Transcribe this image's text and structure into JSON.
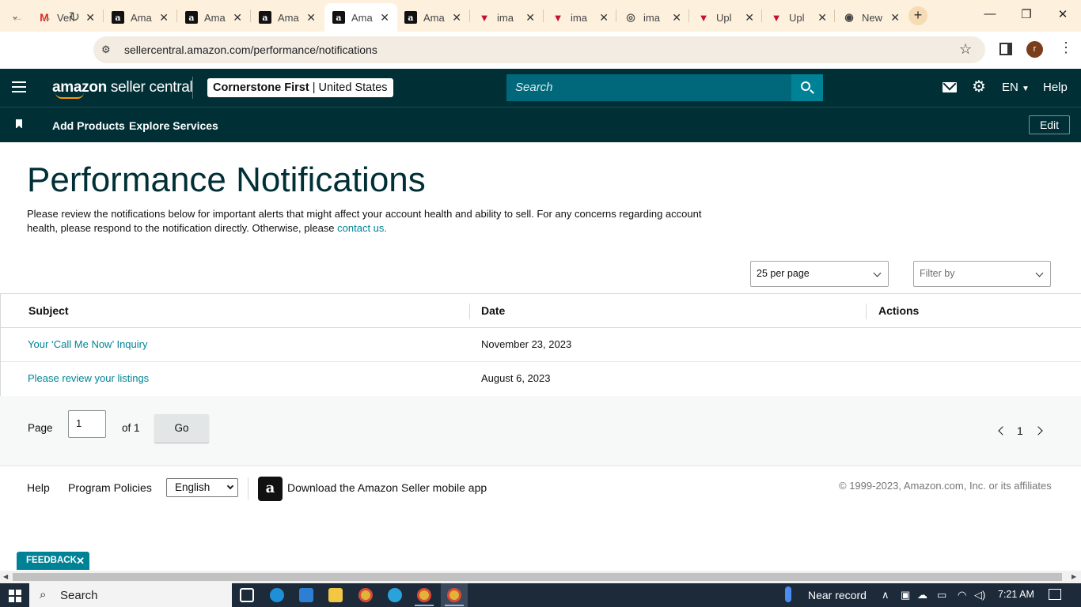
{
  "browser": {
    "tabs": [
      {
        "label": "Veri",
        "icon": "gmail-icon"
      },
      {
        "label": "Ama",
        "icon": "amazon-icon"
      },
      {
        "label": "Ama",
        "icon": "amazon-icon"
      },
      {
        "label": "Ama",
        "icon": "amazon-icon"
      },
      {
        "label": "Ama",
        "icon": "amazon-icon",
        "active": true
      },
      {
        "label": "Ama",
        "icon": "amazon-icon"
      },
      {
        "label": "ima",
        "icon": "pinterest-icon"
      },
      {
        "label": "ima",
        "icon": "pinterest-icon"
      },
      {
        "label": "ima",
        "icon": "globe-icon"
      },
      {
        "label": "Upl",
        "icon": "pinterest-icon"
      },
      {
        "label": "Upl",
        "icon": "pinterest-icon"
      },
      {
        "label": "New",
        "icon": "chrome-icon"
      }
    ],
    "url": "sellercentral.amazon.com/performance/notifications",
    "profile_initial": "r"
  },
  "header": {
    "logo_bold": "amazon",
    "logo_rest": " seller central",
    "account_name": "Cornerstone First",
    "account_sep": " | ",
    "account_region": "United States",
    "search_placeholder": "Search",
    "language": "EN",
    "help": "Help"
  },
  "subnav": {
    "links": [
      "Add Products",
      "Explore Services"
    ],
    "edit": "Edit"
  },
  "page": {
    "title": "Performance Notifications",
    "description": "Please review the notifications below for important alerts that might affect your account health and ability to sell. For any concerns regarding account health, please respond to the notification directly. Otherwise, please ",
    "contact_link": "contact us.",
    "per_page": "25 per page",
    "filter_placeholder": "Filter by"
  },
  "table": {
    "headers": {
      "subject": "Subject",
      "date": "Date",
      "actions": "Actions"
    },
    "rows": [
      {
        "subject": "Your ‘Call Me Now’ Inquiry",
        "date": "November 23, 2023"
      },
      {
        "subject": "Please review your listings",
        "date": "August 6, 2023"
      }
    ]
  },
  "pager": {
    "page_label": "Page",
    "page_value": "1",
    "of_label": "of 1",
    "go": "Go",
    "current_page": "1"
  },
  "footer": {
    "help": "Help",
    "program_policies": "Program Policies",
    "language": "English",
    "app_link": "Download the Amazon Seller mobile app",
    "copyright": "© 1999-2023, Amazon.com, Inc. or its affiliates"
  },
  "feedback": "FEEDBACK",
  "taskbar": {
    "search": "Search",
    "weather": "Near record",
    "time": "7:21 AM"
  },
  "colors": {
    "header_bg": "#002f36",
    "link": "#008296",
    "search_bg": "#00687a",
    "accent_orange": "#ff9900"
  }
}
